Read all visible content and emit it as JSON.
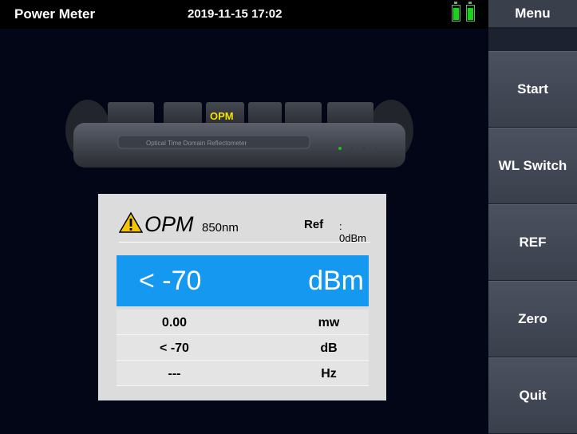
{
  "header": {
    "app_title": "Power Meter",
    "datetime": "2019-11-15 17:02",
    "batteries": 2
  },
  "sidebar": {
    "menu_label": "Menu",
    "buttons": [
      {
        "label": "Start"
      },
      {
        "label": "WL Switch"
      },
      {
        "label": "REF"
      },
      {
        "label": "Zero"
      },
      {
        "label": "Quit"
      }
    ]
  },
  "device": {
    "mode_label": "OPM",
    "caption": "Optical Time Domain Reflectometer"
  },
  "panel": {
    "mode": "OPM",
    "wavelength": "850nm",
    "ref_label": "Ref",
    "ref_value": ": 0dBm",
    "main_value": "< -70",
    "main_unit": "dBm",
    "rows": [
      {
        "value": "0.00",
        "unit": "mw"
      },
      {
        "value": "< -70",
        "unit": "dB"
      },
      {
        "value": "---",
        "unit": "Hz"
      }
    ]
  },
  "colors": {
    "highlight": "#1598f0",
    "battery": "#19d219",
    "mode_label": "#f5e100"
  }
}
